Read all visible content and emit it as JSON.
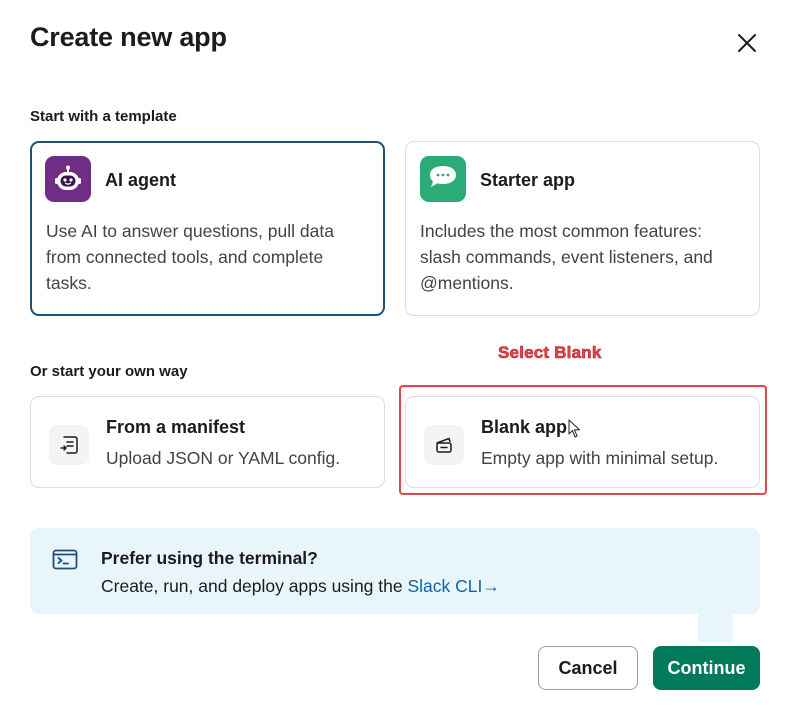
{
  "dialog": {
    "title": "Create new app",
    "close_icon": "close-icon"
  },
  "templates": {
    "heading": "Start with a template",
    "items": [
      {
        "name": "AI agent",
        "description": "Use AI to answer questions, pull data from connected tools, and complete tasks.",
        "icon": "robot-icon",
        "icon_bg": "#6f2d86",
        "selected": true
      },
      {
        "name": "Starter app",
        "description": "Includes the most common features: slash commands, event listeners, and @mentions.",
        "icon": "chat-bubble-icon",
        "icon_bg": "#2bac76",
        "selected": false
      }
    ]
  },
  "own_way": {
    "heading": "Or start your own way",
    "items": [
      {
        "name": "From a manifest",
        "description": "Upload JSON or YAML config.",
        "icon": "manifest-icon"
      },
      {
        "name": "Blank app",
        "description": "Empty app with minimal setup.",
        "icon": "blank-app-icon"
      }
    ]
  },
  "annotation": {
    "text": "Select Blank",
    "color": "#e0474c"
  },
  "terminal_banner": {
    "title": "Prefer using the terminal?",
    "text": "Create, run, and deploy apps using the ",
    "link": "Slack CLI",
    "link_arrow": "→",
    "icon": "terminal-icon"
  },
  "footer": {
    "cancel_label": "Cancel",
    "continue_label": "Continue"
  },
  "colors": {
    "selected_border": "#1d4f77",
    "primary_button": "#007a5a",
    "link": "#1264a3",
    "banner_bg": "#e8f5fa"
  }
}
